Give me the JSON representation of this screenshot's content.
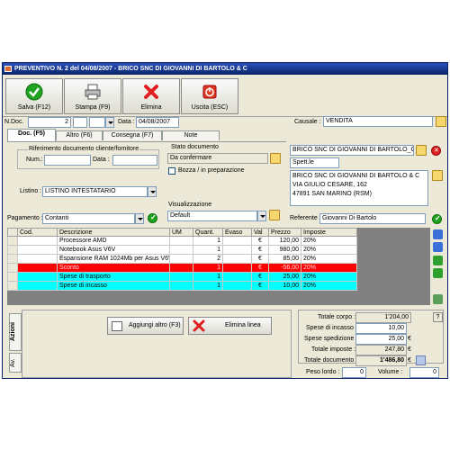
{
  "window": {
    "title": "PREVENTIVO N. 2  del 04/08/2007 - BRICO SNC DI GIOVANNI DI BARTOLO & C"
  },
  "toolbar": {
    "save_label": "Salva (F12)",
    "print_label": "Stampa (F9)",
    "delete_label": "Elimina",
    "exit_label": "Uscita (ESC)"
  },
  "header": {
    "ndoc_label": "N.Doc.",
    "ndoc_value": "2",
    "data_label": "Data :",
    "data_value": "04/08/2007",
    "causale_label": "Causale :",
    "causale_value": "VENDITA"
  },
  "tabs": [
    "Doc. (F5)",
    "Altro (F6)",
    "Consegna (F7)",
    "Note"
  ],
  "doc": {
    "rif_group": "Riferimento documento cliente/fornitore",
    "num_label": "Num.:",
    "num_value": "",
    "data_label": "Data :",
    "data_value": "",
    "stato_group": "Stato documento",
    "stato_value": "Da confermare",
    "bozza_label": "Bozza / in preparazione",
    "listino_label": "Listino :",
    "listino_value": "LISTINO INTESTATARIO",
    "visual_group": "Visualizzazione",
    "visual_value": "Default",
    "pagamento_label": "Pagamento :",
    "pagamento_value": "Contanti"
  },
  "client": {
    "name": "BRICO SNC DI GIOVANNI DI BARTOLO_C",
    "salutation": "Spett.le",
    "address_lines": [
      "BRICO SNC DI GIOVANNI DI BARTOLO & C",
      "VIA GIULIO CESARE, 162",
      "47891  SAN MARINO (RSM)"
    ],
    "referente_label": "Referente",
    "referente_value": "Giovanni Di Bartolo"
  },
  "grid": {
    "columns": [
      "Cod.",
      "Descrizione",
      "UM",
      "Quant.",
      "Evaso",
      "Val",
      "Prezzo",
      "Imposte"
    ],
    "rows": [
      {
        "cod": "",
        "desc": "Processore AMD",
        "um": "",
        "quant": "1",
        "evaso": "",
        "val": "€",
        "prezzo": "120,00",
        "imposte": "20%",
        "style": "normal"
      },
      {
        "cod": "",
        "desc": "Notebook Asus V6V",
        "um": "",
        "quant": "1",
        "evaso": "",
        "val": "€",
        "prezzo": "980,00",
        "imposte": "20%",
        "style": "normal"
      },
      {
        "cod": "",
        "desc": "Espansione RAM 1024Mb per Asus V6V",
        "um": "",
        "quant": "2",
        "evaso": "",
        "val": "€",
        "prezzo": "85,00",
        "imposte": "20%",
        "style": "normal"
      },
      {
        "cod": "",
        "desc": "Sconto",
        "um": "",
        "quant": "1",
        "evaso": "",
        "val": "€",
        "prezzo": "-56,00",
        "imposte": "20%",
        "style": "red"
      },
      {
        "cod": "",
        "desc": "Spese di trasporto",
        "um": "",
        "quant": "1",
        "evaso": "",
        "val": "€",
        "prezzo": "25,00",
        "imposte": "20%",
        "style": "cyan"
      },
      {
        "cod": "",
        "desc": "Spese di incasso",
        "um": "",
        "quant": "1",
        "evaso": "",
        "val": "€",
        "prezzo": "10,00",
        "imposte": "20%",
        "style": "cyan"
      }
    ]
  },
  "actions": {
    "azioni_tab": "Azioni",
    "av_tab": "Av.",
    "add_label": "Aggiungi altro (F3)",
    "remove_label": "Elimina linea"
  },
  "totals": {
    "totale_corpo_label": "Totale corpo :",
    "totale_corpo_value": "1'204,00",
    "spese_incasso_label": "Spese di incasso :",
    "spese_incasso_value": "10,00",
    "spese_spedizione_label": "Spese spedizione :",
    "spese_spedizione_value": "25,00",
    "totale_imposte_label": "Totale imposte :",
    "totale_imposte_value": "247,80",
    "totale_documento_label": "Totale documento :",
    "totale_documento_value": "1'486,80",
    "currency": "€",
    "peso_label": "Peso lordo :",
    "peso_value": "0",
    "volume_label": "Volume :",
    "volume_value": "0",
    "help": "?"
  },
  "colors": {
    "title_bar": "#0a246a",
    "row_red": "#ff0000",
    "row_cyan": "#00ffff",
    "accent_green": "#1fa31f"
  }
}
